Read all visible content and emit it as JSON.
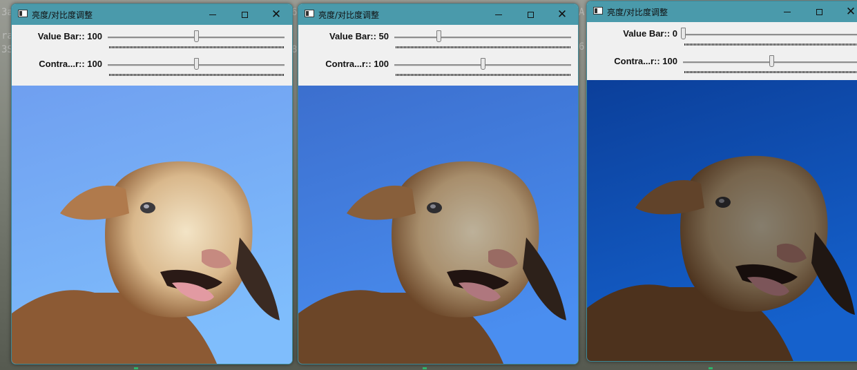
{
  "console_fragments": [
    "3a",
    "ra",
    "3S",
    "6:",
    "8e",
    "A",
    "6"
  ],
  "windows": [
    {
      "title": "亮度/对比度调整",
      "value_label": "Value Bar:: 100",
      "value": 100,
      "contrast_label": "Contra...r:: 100",
      "contrast": 100,
      "sky_top": "#6f9ff0",
      "sky_bottom": "#7fbdfc"
    },
    {
      "title": "亮度/对比度调整",
      "value_label": "Value Bar:: 50",
      "value": 50,
      "contrast_label": "Contra...r:: 100",
      "contrast": 100,
      "sky_top": "#3c6fce",
      "sky_bottom": "#4a8ef0"
    },
    {
      "title": "亮度/对比度调整",
      "value_label": "Value Bar:: 0",
      "value": 0,
      "contrast_label": "Contra...r:: 100",
      "contrast": 100,
      "sky_top": "#0b3f9a",
      "sky_bottom": "#1561cc"
    }
  ],
  "slider_max": 200,
  "icons": {
    "minimize": "minimize-icon",
    "maximize": "maximize-icon",
    "close": "close-icon"
  }
}
